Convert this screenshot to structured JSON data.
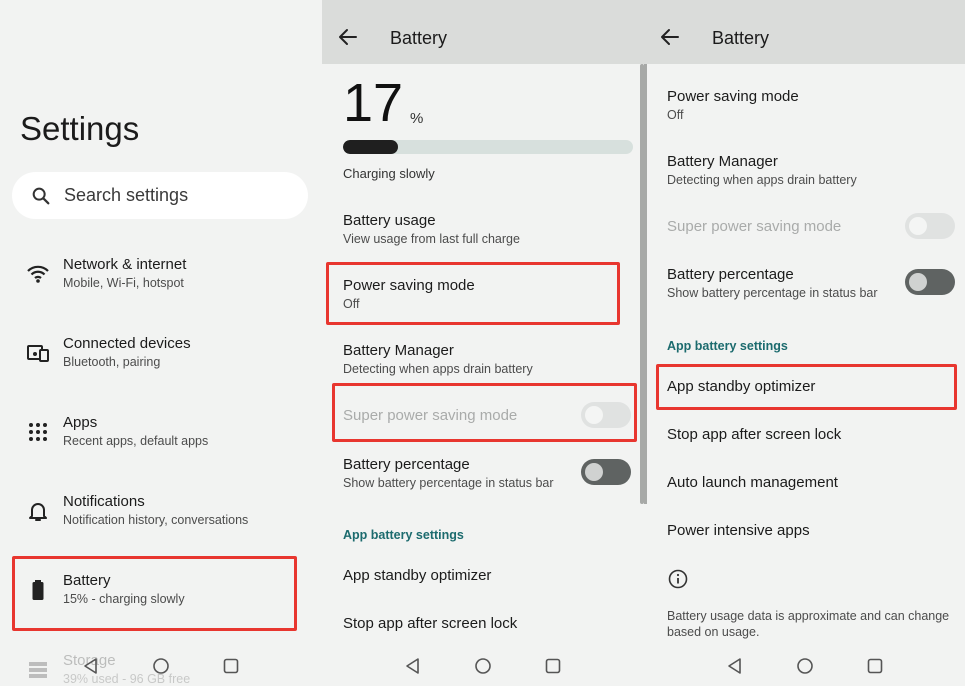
{
  "settings": {
    "title": "Settings",
    "search_placeholder": "Search settings",
    "items": [
      {
        "title": "Network & internet",
        "subtitle": "Mobile, Wi-Fi, hotspot",
        "icon": "wifi-icon"
      },
      {
        "title": "Connected devices",
        "subtitle": "Bluetooth, pairing",
        "icon": "devices-icon"
      },
      {
        "title": "Apps",
        "subtitle": "Recent apps, default apps",
        "icon": "apps-grid-icon"
      },
      {
        "title": "Notifications",
        "subtitle": "Notification history, conversations",
        "icon": "bell-icon"
      },
      {
        "title": "Battery",
        "subtitle": "15% - charging slowly",
        "icon": "battery-icon"
      },
      {
        "title": "Storage",
        "subtitle": "39% used - 96 GB free",
        "icon": "storage-icon"
      }
    ]
  },
  "battery": {
    "title": "Battery",
    "percent": "17",
    "percent_sign": "%",
    "level": 0.19,
    "status": "Charging slowly",
    "usage_title": "Battery usage",
    "usage_subtitle": "View usage from last full charge",
    "power_saving_title": "Power saving mode",
    "power_saving_value": "Off",
    "manager_title": "Battery Manager",
    "manager_subtitle": "Detecting when apps drain battery",
    "super_saving": "Super power saving mode",
    "percentage_title": "Battery percentage",
    "percentage_subtitle": "Show battery percentage in status bar",
    "section": "App battery settings",
    "standby": "App standby optimizer",
    "stop_app": "Stop app after screen lock",
    "auto_launch": "Auto launch management",
    "intensive": "Power intensive apps",
    "footer": "Battery usage data is approximate and can change based on usage."
  },
  "colors": {
    "highlight": "#e8362f",
    "section": "#1c6b6e",
    "background": "#f2f3f2",
    "appbar": "#dadcda"
  }
}
